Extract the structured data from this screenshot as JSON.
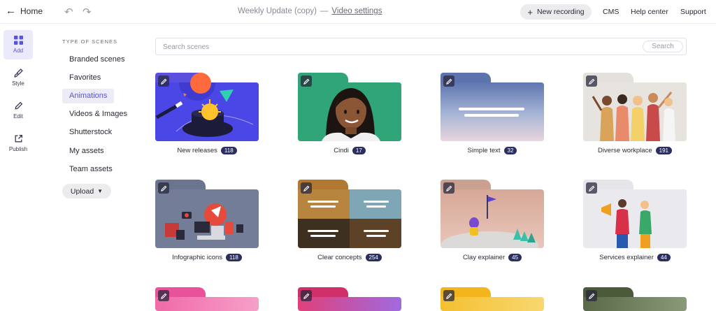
{
  "topbar": {
    "home_label": "Home",
    "project_title": "Weekly Update (copy)",
    "separator": "—",
    "video_settings": "Video settings",
    "new_recording": "New recording",
    "links": [
      "CMS",
      "Help center",
      "Support"
    ]
  },
  "rail": [
    {
      "label": "Add",
      "icon": "grid-icon",
      "active": true
    },
    {
      "label": "Style",
      "icon": "brush-icon",
      "active": false
    },
    {
      "label": "Edit",
      "icon": "pencil-icon",
      "active": false
    },
    {
      "label": "Publish",
      "icon": "share-icon",
      "active": false
    }
  ],
  "categories": {
    "heading": "TYPE OF SCENES",
    "items": [
      "Branded scenes",
      "Favorites",
      "Animations",
      "Videos & Images",
      "Shutterstock",
      "My assets",
      "Team assets"
    ],
    "active": "Animations",
    "upload": "Upload"
  },
  "search": {
    "placeholder": "Search scenes",
    "button": "Search"
  },
  "scenes": [
    {
      "name": "New releases",
      "count": "118"
    },
    {
      "name": "Cindi",
      "count": "17"
    },
    {
      "name": "Simple text",
      "count": "32"
    },
    {
      "name": "Diverse workplace",
      "count": "191"
    },
    {
      "name": "Infographic icons",
      "count": "118"
    },
    {
      "name": "Clear concepts",
      "count": "254"
    },
    {
      "name": "Clay explainer",
      "count": "45"
    },
    {
      "name": "Services explainer",
      "count": "44"
    }
  ],
  "colors": {
    "accent": "#5a55d6",
    "count_badge": "#2b2f5e"
  }
}
